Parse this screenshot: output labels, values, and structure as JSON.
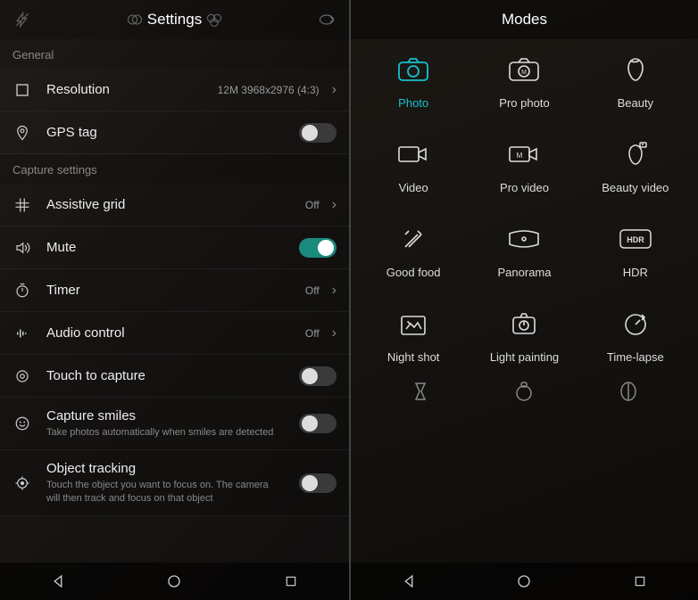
{
  "settings": {
    "title": "Settings",
    "sections": {
      "general": "General",
      "capture": "Capture settings"
    },
    "resolution": {
      "label": "Resolution",
      "value": "12M 3968x2976 (4:3)"
    },
    "gps": {
      "label": "GPS tag",
      "on": false
    },
    "grid": {
      "label": "Assistive grid",
      "value": "Off"
    },
    "mute": {
      "label": "Mute",
      "on": true
    },
    "timer": {
      "label": "Timer",
      "value": "Off"
    },
    "audio": {
      "label": "Audio control",
      "value": "Off"
    },
    "touch": {
      "label": "Touch to capture",
      "on": false
    },
    "smiles": {
      "label": "Capture smiles",
      "sub": "Take photos automatically when smiles are detected",
      "on": false
    },
    "tracking": {
      "label": "Object tracking",
      "sub": "Touch the object you want to focus on. The camera will then track and focus on that object",
      "on": false
    }
  },
  "modes": {
    "title": "Modes",
    "items": [
      {
        "label": "Photo",
        "icon": "camera",
        "active": true
      },
      {
        "label": "Pro photo",
        "icon": "pro-camera"
      },
      {
        "label": "Beauty",
        "icon": "face"
      },
      {
        "label": "Video",
        "icon": "video"
      },
      {
        "label": "Pro video",
        "icon": "pro-video"
      },
      {
        "label": "Beauty video",
        "icon": "face-rec"
      },
      {
        "label": "Good food",
        "icon": "food"
      },
      {
        "label": "Panorama",
        "icon": "panorama"
      },
      {
        "label": "HDR",
        "icon": "hdr"
      },
      {
        "label": "Night shot",
        "icon": "night"
      },
      {
        "label": "Light painting",
        "icon": "light-paint"
      },
      {
        "label": "Time-lapse",
        "icon": "timelapse"
      }
    ]
  }
}
